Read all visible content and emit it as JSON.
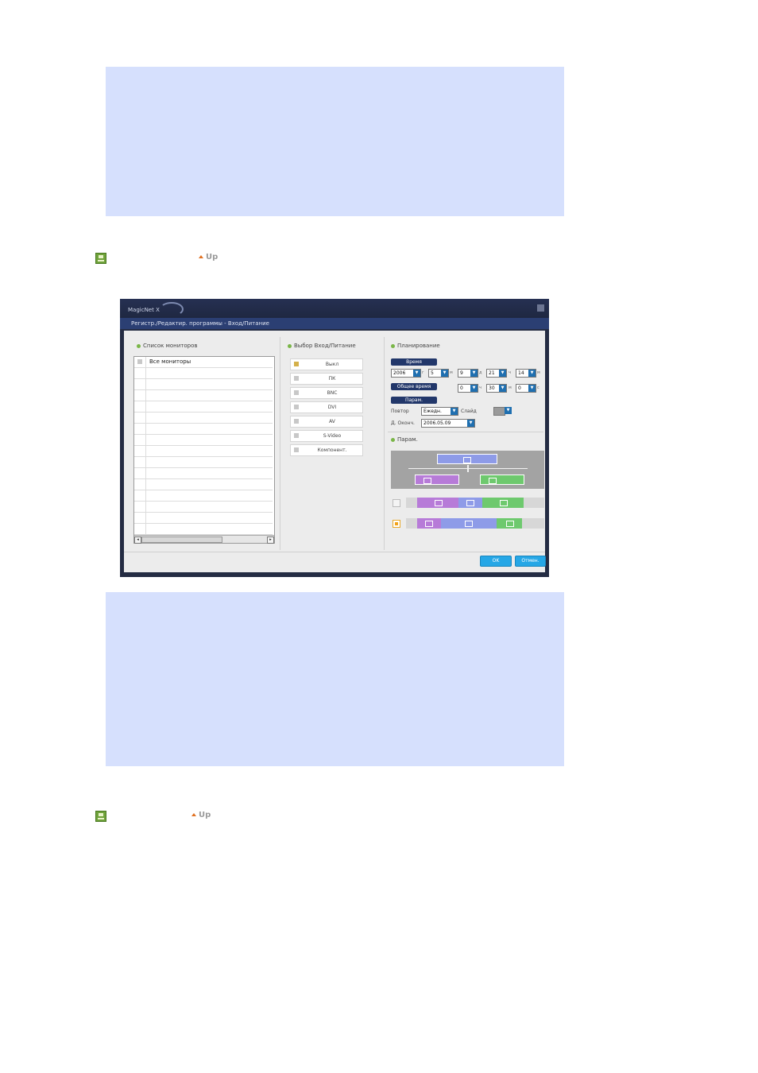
{
  "up_links": [
    {
      "label": "Up"
    },
    {
      "label": "Up"
    }
  ],
  "window": {
    "app_name": "MagicNet X",
    "subtitle": "Регистр./Редактир. программы - Вход/Питание",
    "monitor_section": {
      "title": "Список мониторов",
      "items": [
        "Все мониторы"
      ]
    },
    "input_section": {
      "title": "Выбор Вход/Питание",
      "options": [
        {
          "label": "Выкл",
          "checked": true
        },
        {
          "label": "ПК",
          "checked": false
        },
        {
          "label": "BNC",
          "checked": false
        },
        {
          "label": "DVI",
          "checked": false
        },
        {
          "label": "AV",
          "checked": false
        },
        {
          "label": "S-Video",
          "checked": false
        },
        {
          "label": "Компонент.",
          "checked": false
        }
      ]
    },
    "schedule_section": {
      "title": "Планирование",
      "time_button": "Время",
      "year": "2006",
      "year_unit": "г",
      "month": "5",
      "month_unit": "м",
      "day": "9",
      "day_unit": "д",
      "hour": "21",
      "hour_unit": "ч",
      "minute": "14",
      "minute_unit": "м",
      "total_time_button": "Общее время",
      "dur_hour": "0",
      "dur_hour_unit": "ч",
      "dur_min": "30",
      "dur_min_unit": "м",
      "dur_sec": "0",
      "dur_sec_unit": "с",
      "param_button": "Парам.",
      "repeat_label": "Повтор",
      "repeat_value": "Ежедн.",
      "slide_label": "Слайд",
      "end_date_label": "Д. Оконч.",
      "end_date_value": "2006.05.09",
      "param_title": "Парам."
    },
    "ok_button": "OK",
    "cancel_button": "Отмен."
  },
  "colors": {
    "blue_panel": "#d6e0fd",
    "window_frame": "#242c43",
    "accent_blue": "#26a7e6",
    "purple_block": "#b77bd8",
    "green_block": "#6ec96e",
    "lavender_block": "#8e9be8"
  }
}
